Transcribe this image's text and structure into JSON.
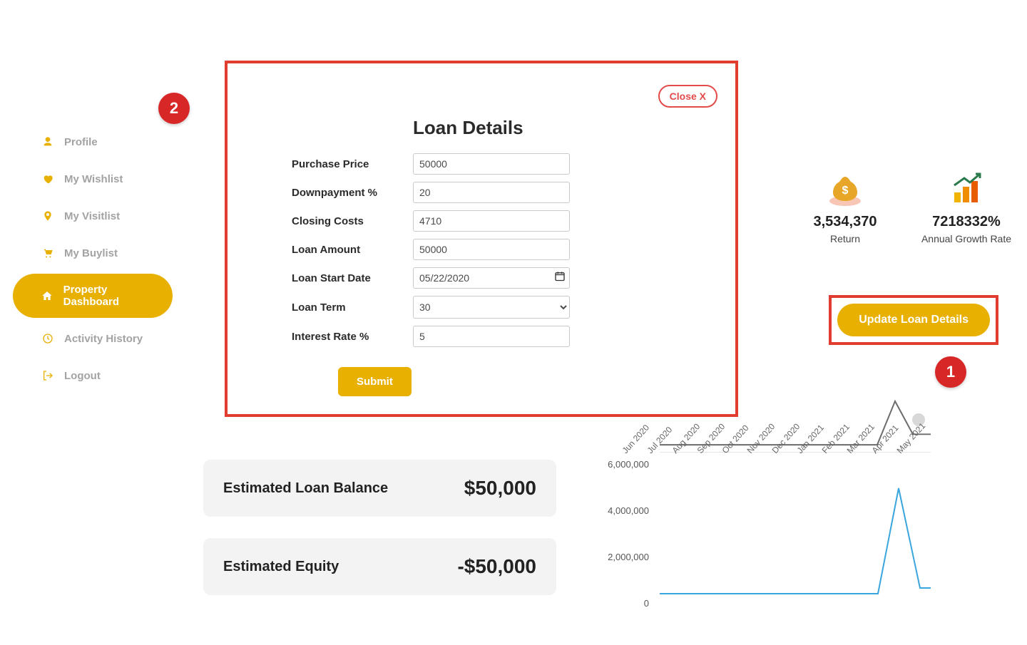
{
  "sidebar": {
    "items": [
      {
        "label": "Profile",
        "icon": "user"
      },
      {
        "label": "My Wishlist",
        "icon": "heart"
      },
      {
        "label": "My Visitlist",
        "icon": "pin"
      },
      {
        "label": "My Buylist",
        "icon": "cart"
      },
      {
        "label": "Property Dashboard",
        "icon": "home",
        "active": true
      },
      {
        "label": "Activity History",
        "icon": "clock"
      },
      {
        "label": "Logout",
        "icon": "exit"
      }
    ]
  },
  "metrics": [
    {
      "value": "3,534,370",
      "label": "Return"
    },
    {
      "value": "7218332%",
      "label": "Annual Growth Rate"
    }
  ],
  "update_button": "Update Loan Details",
  "badges": {
    "one": "1",
    "two": "2"
  },
  "modal": {
    "title": "Loan Details",
    "close": "Close X",
    "fields": {
      "purchase_price": {
        "label": "Purchase Price",
        "value": "50000"
      },
      "downpayment": {
        "label": "Downpayment %",
        "value": "20"
      },
      "closing_costs": {
        "label": "Closing Costs",
        "value": "4710"
      },
      "loan_amount": {
        "label": "Loan Amount",
        "value": "50000"
      },
      "loan_start_date": {
        "label": "Loan Start Date",
        "value": "05/22/2020"
      },
      "loan_term": {
        "label": "Loan Term",
        "value": "30"
      },
      "interest_rate": {
        "label": "Interest Rate %",
        "value": "5"
      }
    },
    "submit": "Submit"
  },
  "cards": [
    {
      "title": "Estimated Loan Balance",
      "value": "$50,000"
    },
    {
      "title": "Estimated Equity",
      "value": "-$50,000"
    }
  ],
  "chart_data": {
    "type": "line",
    "categories": [
      "Jun 2020",
      "Jul 2020",
      "Aug 2020",
      "Sep 2020",
      "Oct 2020",
      "Nov 2020",
      "Dec 2020",
      "Jan 2021",
      "Feb 2021",
      "Mar 2021",
      "Apr 2021",
      "May 2021"
    ],
    "y_ticks": [
      "6,000,000",
      "4,000,000",
      "2,000,000",
      "0"
    ],
    "ylim": [
      0,
      6000000
    ],
    "series": [
      {
        "name": "main",
        "color": "#3aa6dd",
        "values": [
          0,
          0,
          0,
          0,
          0,
          0,
          0,
          0,
          0,
          0,
          5200000,
          300000
        ]
      },
      {
        "name": "spark",
        "color": "#6b6b6b",
        "values": [
          0,
          0,
          0,
          0,
          0,
          0,
          0,
          0,
          0,
          1,
          0.2
        ]
      }
    ]
  }
}
